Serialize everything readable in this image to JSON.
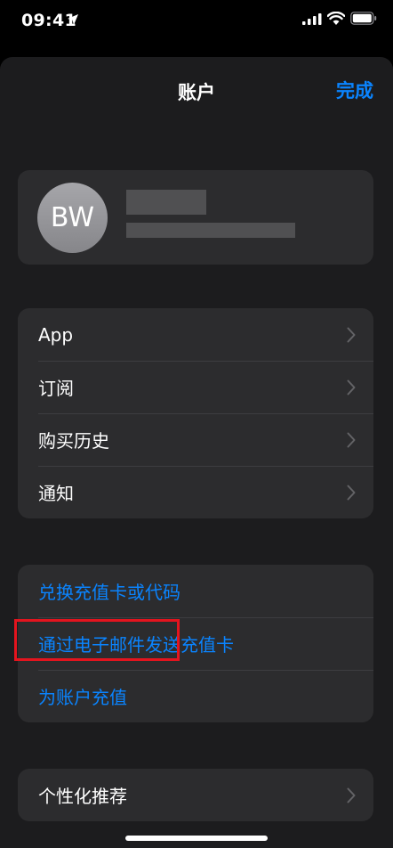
{
  "status_bar": {
    "time": "09:41"
  },
  "nav": {
    "title": "账户",
    "done_label": "完成"
  },
  "profile": {
    "initials": "BW"
  },
  "list1": [
    {
      "label": "App"
    },
    {
      "label": "订阅"
    },
    {
      "label": "购买历史"
    },
    {
      "label": "通知"
    }
  ],
  "list2": [
    {
      "label": "兑换充值卡或代码"
    },
    {
      "label": "通过电子邮件发送充值卡"
    },
    {
      "label": "为账户充值"
    }
  ],
  "list3": [
    {
      "label": "个性化推荐"
    }
  ],
  "colors": {
    "accent": "#0a84ff",
    "highlight": "#e4141e",
    "card": "#2c2c2e",
    "sheet": "#1c1c1e"
  }
}
